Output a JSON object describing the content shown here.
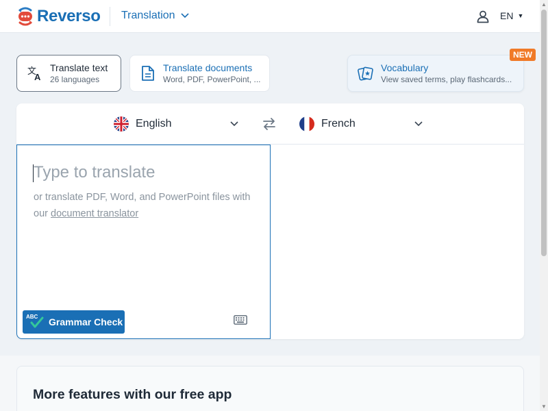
{
  "header": {
    "brand": "Reverso",
    "nav_label": "Translation",
    "ui_language": "EN"
  },
  "modes": {
    "text": {
      "title": "Translate text",
      "subtitle": "26 languages"
    },
    "documents": {
      "title": "Translate documents",
      "subtitle": "Word, PDF, PowerPoint, ..."
    },
    "vocabulary": {
      "title": "Vocabulary",
      "subtitle": "View saved terms, play flashcards...",
      "badge": "NEW"
    }
  },
  "translator": {
    "source_language": "English",
    "target_language": "French",
    "placeholder": "Type to translate",
    "hint_prefix": "or translate PDF, Word, and PowerPoint files with our ",
    "hint_link": "document translator",
    "grammar_badge": "ABC",
    "grammar_label": "Grammar Check"
  },
  "features": {
    "heading": "More features with our free app"
  },
  "colors": {
    "brand_blue": "#1a6fb5",
    "badge_orange": "#f07a28",
    "grammar_check_green": "#34c89a"
  }
}
